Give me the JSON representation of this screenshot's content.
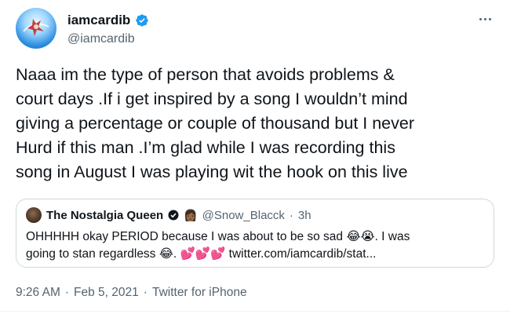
{
  "author": {
    "display_name": "iamcardib",
    "handle": "@iamcardib",
    "verified": true
  },
  "tweet": {
    "text_lines": [
      "Naaa im the type of person that avoids problems &",
      "court days .If i get inspired by a song I wouldn’t mind",
      "giving a percentage or couple of thousand but I never",
      "Hurd if this man .I’m glad while I was recording this",
      "song in August I was playing wit the hook on this live"
    ]
  },
  "quoted_tweet": {
    "display_name": "The Nostalgia Queen",
    "name_emoji": "👩🏾",
    "handle": "@Snow_Blacck",
    "separator": "·",
    "time": "3h",
    "text_lines": [
      "OHHHHH okay PERIOD because I was about to be so sad 😂😭. I was",
      "going to stan regardless 😂. 💕💕💕 twitter.com/iamcardib/stat..."
    ]
  },
  "meta": {
    "time": "9:26 AM",
    "sep1": "·",
    "date": "Feb 5, 2021",
    "sep2": "·",
    "client": "Twitter for iPhone"
  },
  "colors": {
    "text": "#0f1419",
    "secondary": "#536471",
    "verified_blue": "#1d9bf0",
    "border": "#cfd9de"
  },
  "icons": {
    "verified": "verified-badge-icon",
    "more": "more-dots-icon",
    "quoted_badge": "black-circle-badge-icon"
  }
}
